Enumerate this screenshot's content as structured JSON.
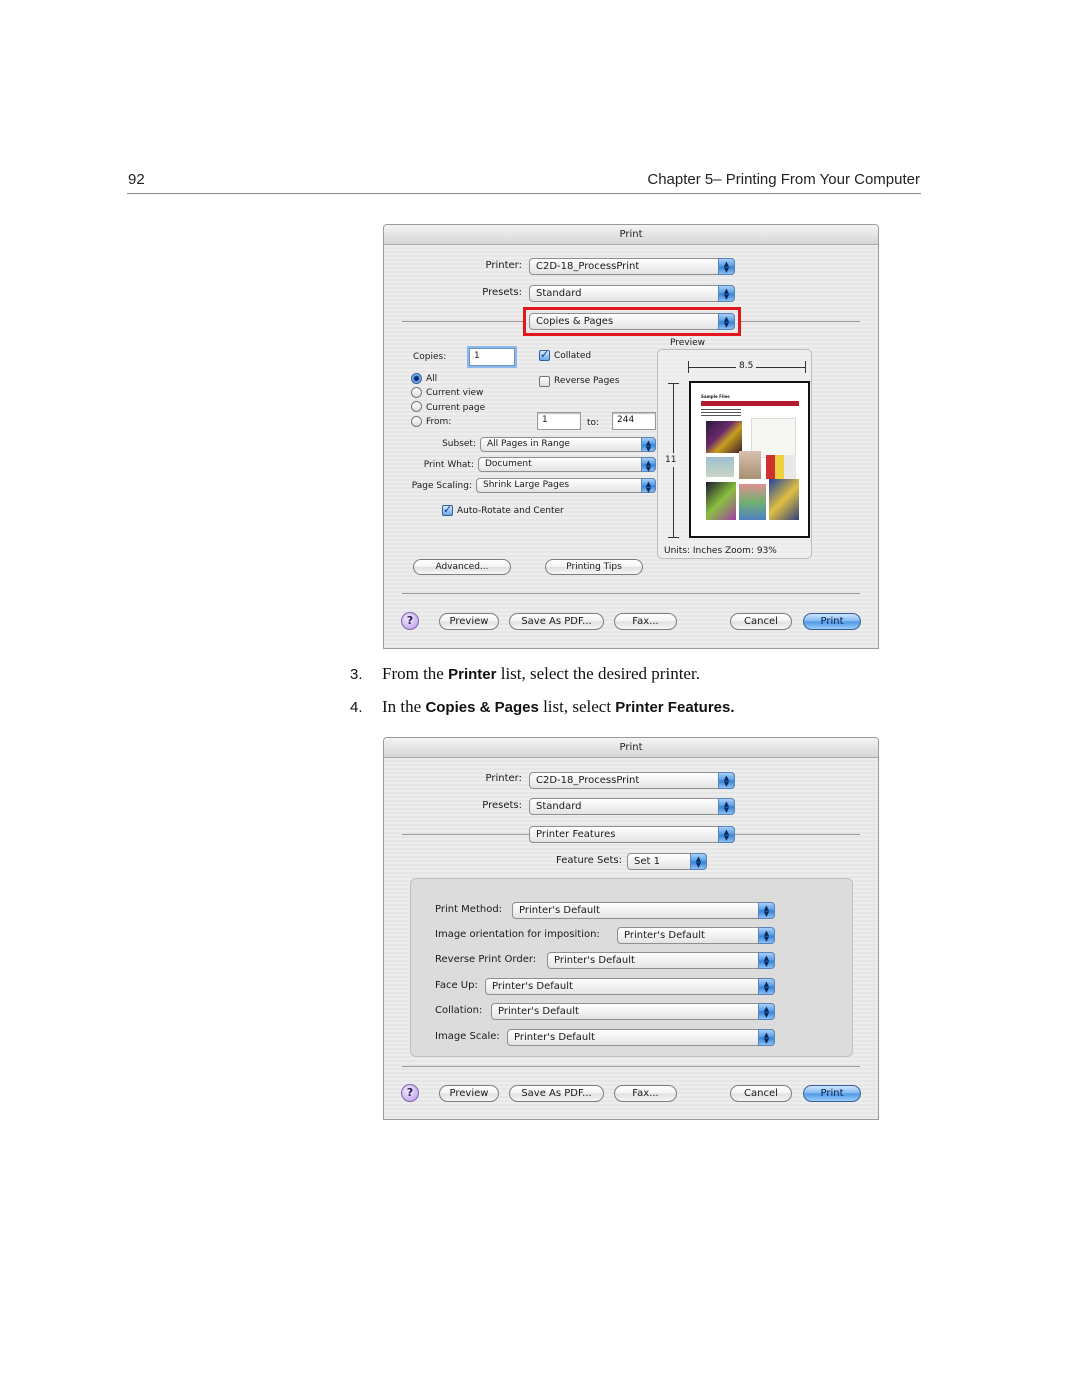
{
  "page_header": {
    "page_number": "92",
    "chapter_title": "Chapter 5– Printing From Your Computer"
  },
  "dialog1": {
    "title": "Print",
    "printer_label": "Printer:",
    "printer_value": "C2D-18_ProcessPrint",
    "presets_label": "Presets:",
    "presets_value": "Standard",
    "panel_value": "Copies & Pages",
    "highlight_color": "#e3161e",
    "copies_label": "Copies:",
    "copies_value": "1",
    "collated_label": "Collated",
    "collated_checked": true,
    "reverse_pages_label": "Reverse Pages",
    "reverse_pages_checked": false,
    "pages_options": [
      {
        "label": "All",
        "selected": true
      },
      {
        "label": "Current view",
        "selected": false
      },
      {
        "label": "Current page",
        "selected": false
      },
      {
        "label": "From:",
        "selected": false
      }
    ],
    "from_value": "1",
    "to_label": "to:",
    "to_value": "244",
    "subset_label": "Subset:",
    "subset_value": "All Pages in Range",
    "print_what_label": "Print What:",
    "print_what_value": "Document",
    "page_scaling_label": "Page Scaling:",
    "page_scaling_value": "Shrink Large Pages",
    "auto_rotate_label": "Auto-Rotate and Center",
    "auto_rotate_checked": true,
    "preview": {
      "label": "Preview",
      "width_dimension": "8.5",
      "height_dimension": "11",
      "thumb_title": "Sample Files",
      "units_label": "Units: Inches  Zoom:  93%"
    },
    "advanced_button": "Advanced...",
    "printing_tips_button": "Printing Tips",
    "footer": {
      "help": "?",
      "preview_button": "Preview",
      "save_pdf_button": "Save As PDF...",
      "fax_button": "Fax...",
      "cancel_button": "Cancel",
      "print_button": "Print"
    }
  },
  "instructions": [
    {
      "number": "3.",
      "pre": "From the ",
      "bold": "Printer",
      "mid": " list, select the desired printer.",
      "bold2": "",
      "post": ""
    },
    {
      "number": "4.",
      "pre": "In the ",
      "bold": "Copies & Pages",
      "mid": " list, select ",
      "bold2": "Printer Features",
      "post": "."
    }
  ],
  "dialog2": {
    "title": "Print",
    "printer_label": "Printer:",
    "printer_value": "C2D-18_ProcessPrint",
    "presets_label": "Presets:",
    "presets_value": "Standard",
    "panel_value": "Printer Features",
    "feature_sets_label": "Feature Sets:",
    "feature_sets_value": "Set 1",
    "features": [
      {
        "label": "Print Method:",
        "value": "Printer's Default"
      },
      {
        "label": "Image orientation for imposition:",
        "value": "Printer's Default"
      },
      {
        "label": "Reverse Print Order:",
        "value": "Printer's Default"
      },
      {
        "label": "Face Up:",
        "value": "Printer's Default"
      },
      {
        "label": "Collation:",
        "value": "Printer's Default"
      },
      {
        "label": "Image Scale:",
        "value": "Printer's Default"
      }
    ],
    "footer": {
      "help": "?",
      "preview_button": "Preview",
      "save_pdf_button": "Save As PDF...",
      "fax_button": "Fax...",
      "cancel_button": "Cancel",
      "print_button": "Print"
    }
  }
}
